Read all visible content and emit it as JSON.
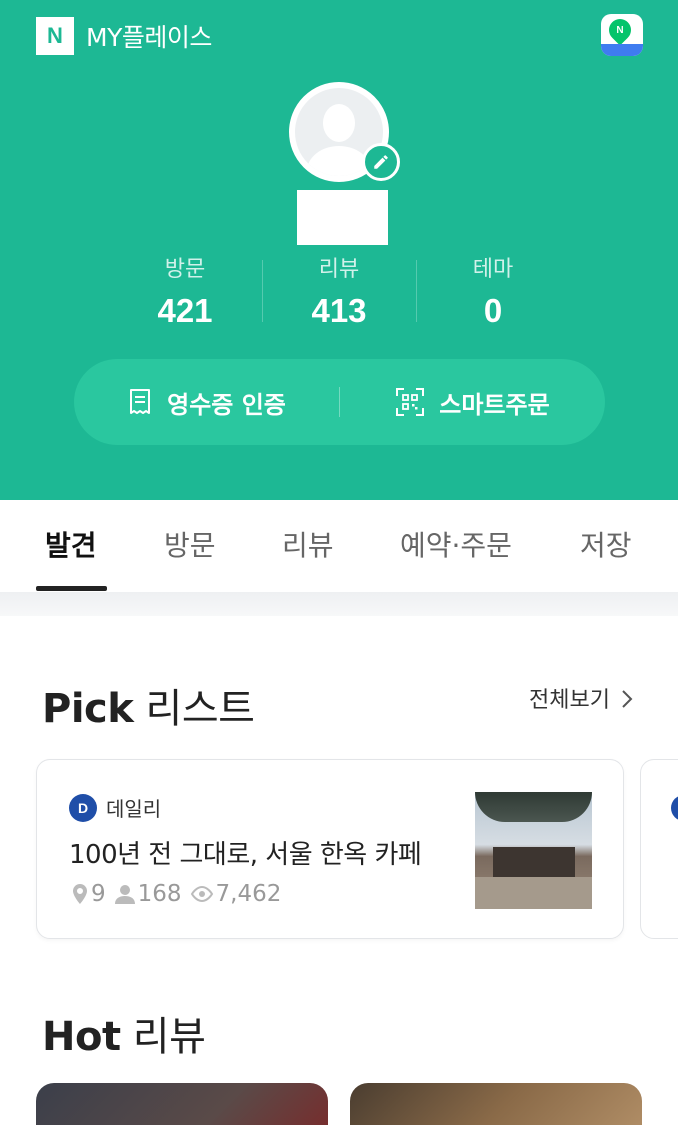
{
  "app": {
    "brand_letter": "N",
    "title": "MY플레이스",
    "colors": {
      "accent": "#1db894",
      "accent_light": "#2ac79f",
      "thumbnail_logo": "#1f4ea8"
    }
  },
  "header": {
    "map_icon": "naver-map-icon",
    "map_icon_letter": "N",
    "avatar_icon": "default-profile-icon",
    "edit_icon": "pencil-icon"
  },
  "stats": [
    {
      "label": "방문",
      "value": "421"
    },
    {
      "label": "리뷰",
      "value": "413"
    },
    {
      "label": "테마",
      "value": "0"
    }
  ],
  "actions": {
    "receipt": {
      "label": "영수증 인증",
      "icon": "receipt-icon"
    },
    "smart_order": {
      "label": "스마트주문",
      "icon": "qr-scan-icon"
    }
  },
  "tabs": [
    {
      "label": "발견",
      "active": true
    },
    {
      "label": "방문",
      "active": false
    },
    {
      "label": "리뷰",
      "active": false
    },
    {
      "label": "예약·주문",
      "active": false
    },
    {
      "label": "저장",
      "active": false
    }
  ],
  "pick": {
    "title_bold": "Pick",
    "title_rest": " 리스트",
    "see_all": "전체보기",
    "cards": [
      {
        "source_logo_letter": "D",
        "source": "데일리",
        "title": "100년 전 그대로, 서울 한옥 카페",
        "places": "9",
        "followers": "168",
        "views": "7,462"
      }
    ]
  },
  "hot": {
    "title_bold": "Hot",
    "title_rest": " 리뷰"
  }
}
